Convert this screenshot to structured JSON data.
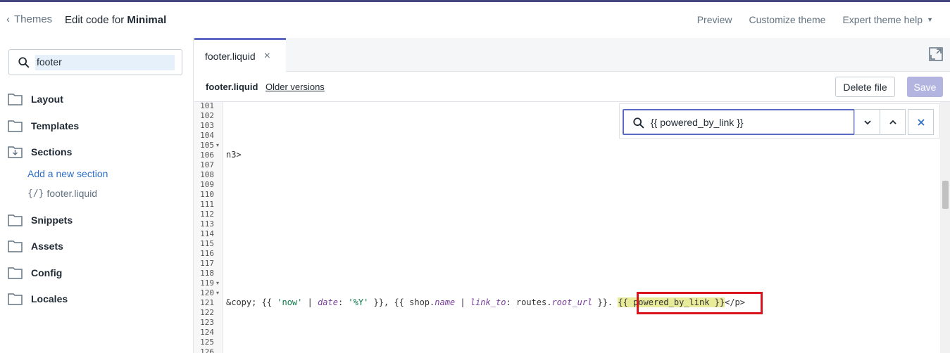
{
  "topbar": {
    "back_label": "Themes",
    "title_prefix": "Edit code for",
    "theme_name": "Minimal",
    "links": [
      "Preview",
      "Customize theme",
      "Expert theme help"
    ]
  },
  "sidebar": {
    "search_value": "footer",
    "folders": {
      "layout": "Layout",
      "templates": "Templates",
      "sections": "Sections",
      "snippets": "Snippets",
      "assets": "Assets",
      "config": "Config",
      "locales": "Locales"
    },
    "add_section": "Add a new section",
    "file_brace": "{/}",
    "file_name": "footer.liquid"
  },
  "tab": {
    "label": "footer.liquid",
    "close": "×"
  },
  "filebar": {
    "file_name": "footer.liquid",
    "older_versions": "Older versions",
    "delete_label": "Delete file",
    "save_label": "Save"
  },
  "find": {
    "query": "{{ powered_by_link }}"
  },
  "editor": {
    "line_numbers": [
      "101",
      "102",
      "103",
      "104",
      "105",
      "106",
      "107",
      "108",
      "109",
      "110",
      "111",
      "112",
      "113",
      "114",
      "115",
      "116",
      "117",
      "118",
      "119",
      "120",
      "121",
      "122",
      "123",
      "124",
      "125",
      "126"
    ],
    "fold_lines": [
      "105",
      "119",
      "120"
    ],
    "line_106": "n3>",
    "line_121": {
      "t1": "&copy; {{ ",
      "s1": "'now'",
      "t2": " | ",
      "k1": "date",
      "t3": ": ",
      "s2": "'%Y'",
      "t4": " }}, {{ shop.",
      "k2": "name",
      "t5": " | ",
      "k3": "link_to",
      "t6": ": routes.",
      "k4": "root_url",
      "t7": " }}. ",
      "hl": "{{ powered_by_link }}",
      "t8": "</p>"
    }
  }
}
